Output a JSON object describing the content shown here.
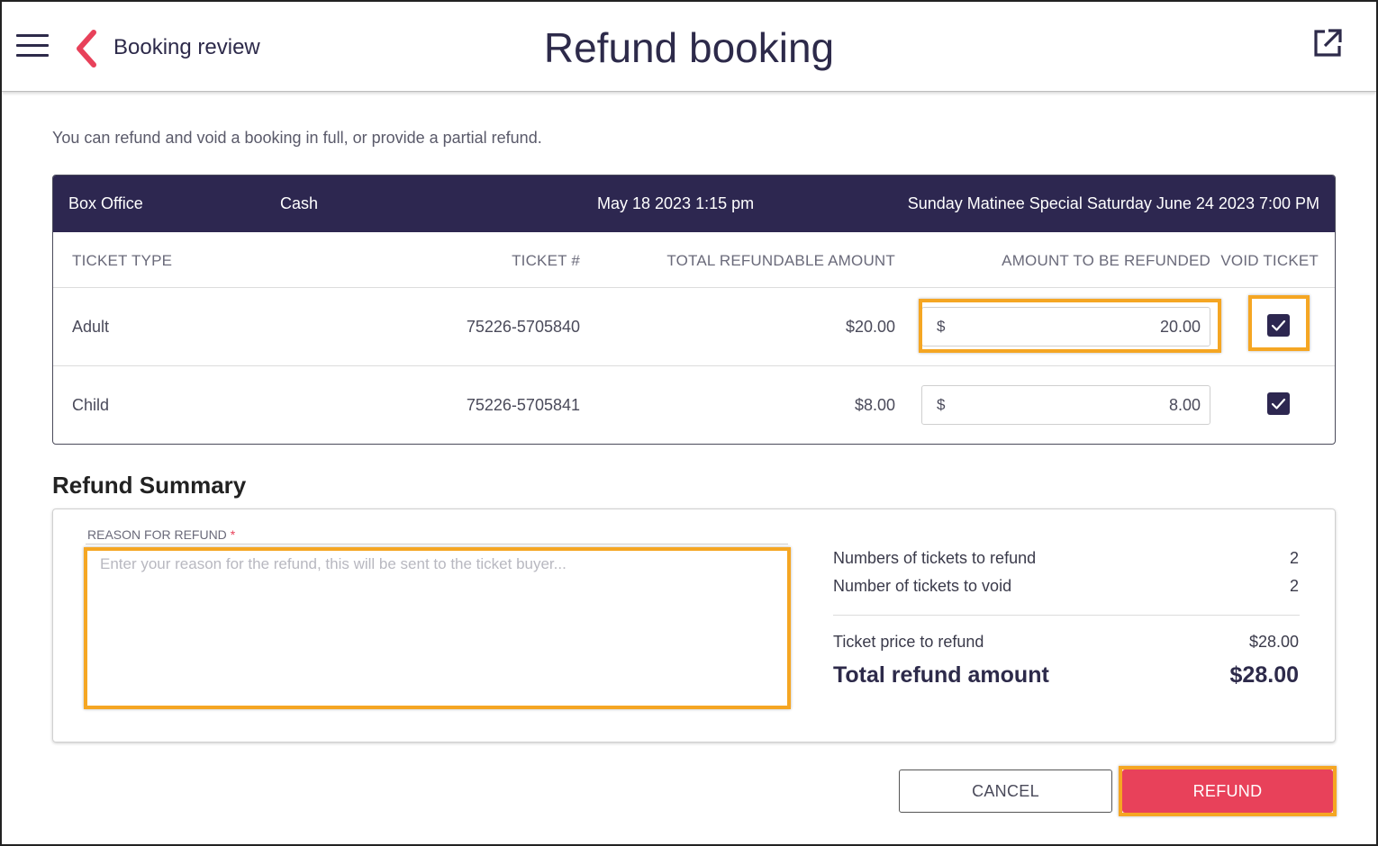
{
  "header": {
    "back_label": "Booking review",
    "title": "Refund booking"
  },
  "intro_text": "You can refund and void a booking in full, or provide a partial refund.",
  "booking": {
    "location": "Box Office",
    "payment": "Cash",
    "date": "May 18 2023 1:15 pm",
    "event": "Sunday Matinee Special Saturday June 24 2023 7:00 PM",
    "columns": {
      "ticket_type": "TICKET TYPE",
      "ticket_no": "TICKET #",
      "refundable": "TOTAL REFUNDABLE AMOUNT",
      "amount": "AMOUNT TO BE REFUNDED",
      "void": "VOID TICKET"
    },
    "rows": [
      {
        "type": "Adult",
        "ticket_no": "75226-5705840",
        "refundable": "$20.00",
        "currency": "$",
        "amount": "20.00",
        "void": true
      },
      {
        "type": "Child",
        "ticket_no": "75226-5705841",
        "refundable": "$8.00",
        "currency": "$",
        "amount": "8.00",
        "void": true
      }
    ]
  },
  "summary": {
    "title": "Refund Summary",
    "reason_label": "REASON FOR REFUND",
    "reason_required_mark": "*",
    "reason_placeholder": "Enter your reason for the refund, this will be sent to the ticket buyer...",
    "tickets_refund_label": "Numbers of tickets to refund",
    "tickets_refund_value": "2",
    "tickets_void_label": "Number of tickets to void",
    "tickets_void_value": "2",
    "price_label": "Ticket price to refund",
    "price_value": "$28.00",
    "total_label": "Total refund amount",
    "total_value": "$28.00"
  },
  "buttons": {
    "cancel": "CANCEL",
    "refund": "REFUND"
  },
  "colors": {
    "brand_dark": "#2d2750",
    "accent": "#e8415a",
    "highlight": "#f5a623"
  }
}
